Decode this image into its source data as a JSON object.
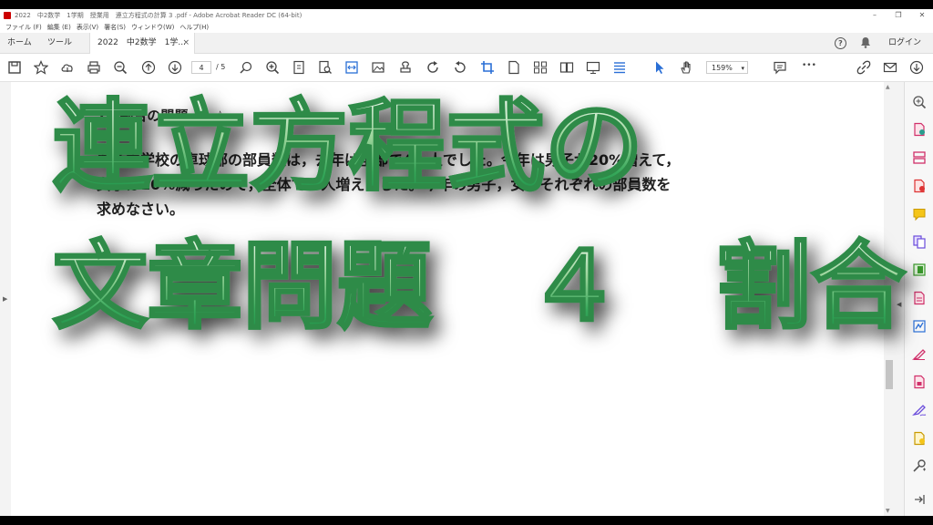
{
  "window": {
    "title": "2022　中2数学　1学期　授業用　連立方程式の計算 3 .pdf - Adobe Acrobat Reader DC (64-bit)",
    "controls": {
      "minimize": "–",
      "restore": "❐",
      "close": "✕"
    }
  },
  "menu": [
    "ファイル (F)",
    "編集 (E)",
    "表示(V)",
    "署名(S)",
    "ウィンドウ(W)",
    "ヘルプ(H)"
  ],
  "tabs": {
    "home": "ホーム",
    "tools": "ツール",
    "document": "2022　中2数学　1学...",
    "close": "×",
    "login": "ログイン",
    "help": "?"
  },
  "toolbar": {
    "page_current": "4",
    "page_total": "/  5",
    "zoom": "159%",
    "zoom_dropdown": "▾",
    "more": "•••"
  },
  "document": {
    "heading": "7　割合の問題　☆☆",
    "line1": "ある中学校の卓球部の部員数は，去年は全部で40 人でした。今年は男子が20%増えて，",
    "line2": "女子は10%減ったので，全体で1 人増えました。今年の男子，女子それぞれの部員数を",
    "line3": "求めなさい。"
  },
  "overlay": {
    "line1": "連立方程式の",
    "line2": "文章問題　４　割合"
  },
  "colors": {
    "overlay_fill_top": "#eaf7ea",
    "overlay_fill_bottom": "#1f8f48",
    "overlay_stroke": "#2e8b48",
    "accent_blue": "#2a6fd6",
    "acrobat_red": "#cc0000"
  },
  "tools_panel": [
    "zoom-icon",
    "export-pdf-icon",
    "organize-pages-icon",
    "create-pdf-icon",
    "comment-icon",
    "combine-files-icon",
    "scan-icon",
    "edit-pdf-icon",
    "fill-sign-icon",
    "request-signature-icon",
    "protect-icon",
    "sign-icon",
    "send-for-review-icon",
    "more-tools-icon",
    "collapse-panel-icon"
  ]
}
